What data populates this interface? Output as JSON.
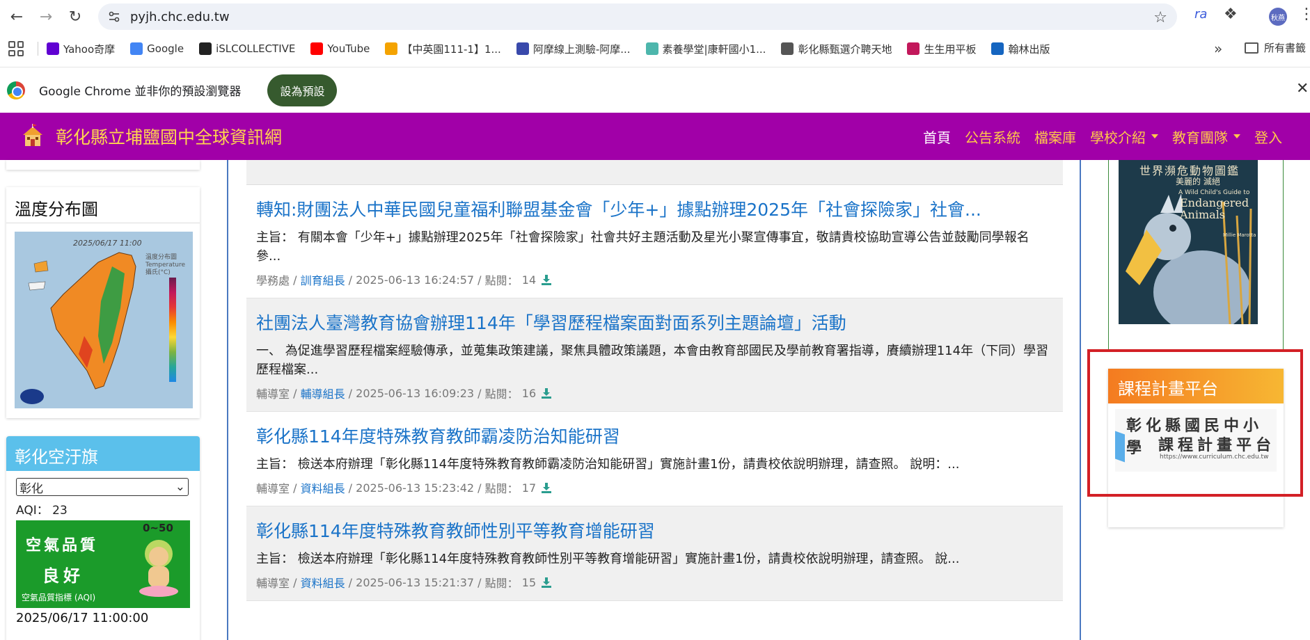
{
  "browser": {
    "url": "pyjh.chc.edu.tw",
    "extension_ra": "ra",
    "profile_initials": "秋燕"
  },
  "bookmarks": {
    "items": [
      {
        "label": "Yahoo奇摩",
        "icon": "yahoo-icon",
        "color": "#6001d2"
      },
      {
        "label": "Google",
        "icon": "google-icon",
        "color": "#4285f4"
      },
      {
        "label": "iSLCOLLECTIVE",
        "icon": "isl-icon",
        "color": "#222222"
      },
      {
        "label": "YouTube",
        "icon": "youtube-icon",
        "color": "#ff0000"
      },
      {
        "label": "【中英園111-1】1...",
        "icon": "pinwheel-icon",
        "color": "#f4a300"
      },
      {
        "label": "阿摩線上測驗-阿摩...",
        "icon": "amo-icon",
        "color": "#3949ab"
      },
      {
        "label": "素養學堂|康軒國小1...",
        "icon": "kangxuan-icon",
        "color": "#4db6ac"
      },
      {
        "label": "彰化縣甄選介聘天地",
        "icon": "globe-icon",
        "color": "#555555"
      },
      {
        "label": "生生用平板",
        "icon": "tablet-icon",
        "color": "#c2185b"
      },
      {
        "label": "翰林出版",
        "icon": "hanlin-icon",
        "color": "#1565c0"
      }
    ],
    "all_bookmarks": "所有書籤"
  },
  "infobar": {
    "message": "Google Chrome 並非你的預設瀏覽器",
    "button": "設為預設"
  },
  "site": {
    "title": "彰化縣立埔鹽國中全球資訊網",
    "nav": [
      {
        "label": "首頁",
        "active": true,
        "dropdown": false
      },
      {
        "label": "公告系統",
        "active": false,
        "dropdown": false
      },
      {
        "label": "檔案庫",
        "active": false,
        "dropdown": false
      },
      {
        "label": "學校介紹",
        "active": false,
        "dropdown": true
      },
      {
        "label": "教育團隊",
        "active": false,
        "dropdown": true
      },
      {
        "label": "登入",
        "active": false,
        "dropdown": false
      }
    ],
    "header_color": "#a100a8",
    "nav_color": "#ffc94a"
  },
  "temperature": {
    "title": "溫度分布圖",
    "map_date": "2025/06/17 11:00",
    "legend_title": "溫度分布圖 Temperature 攝氏(°C)"
  },
  "aqi": {
    "title": "彰化空汙旗",
    "selected_station": "彰化",
    "label": "AQI：",
    "value": "23",
    "banner_line1": "空氣品質",
    "banner_line2": "良好",
    "banner_caption": "空氣品質指標 (AQI)",
    "banner_range": "0~50",
    "timestamp": "2025/06/17 11:00:00"
  },
  "news": [
    {
      "title": "轉知:財團法人中華民國兒童福利聯盟基金會「少年+」據點辦理2025年「社會探險家」社會...",
      "body": "主旨： 有關本會「少年+」據點辦理2025年「社會探險家」社會共好主題活動及星光小聚宣傳事宜，敬請貴校協助宣導公告並鼓勵同學報名參...",
      "office": "學務處",
      "role": "訓育組長",
      "datetime": "2025-06-13 16:24:57",
      "hits_label": "點閱：",
      "hits": "14"
    },
    {
      "title": "社團法人臺灣教育協會辦理114年「學習歷程檔案面對面系列主題論壇」活動",
      "body": "一、 為促進學習歷程檔案經驗傳承，並蒐集政策建議，聚焦具體政策議題，本會由教育部國民及學前教育署指導，賡續辦理114年（下同）學習歷程檔案...",
      "office": "輔導室",
      "role": "輔導組長",
      "datetime": "2025-06-13 16:09:23",
      "hits_label": "點閱：",
      "hits": "16"
    },
    {
      "title": "彰化縣114年度特殊教育教師霸凌防治知能研習",
      "body": "主旨： 檢送本府辦理「彰化縣114年度特殊教育教師霸凌防治知能研習」實施計畫1份，請貴校依說明辦理，請查照。 說明：...",
      "office": "輔導室",
      "role": "資料組長",
      "datetime": "2025-06-13 15:23:42",
      "hits_label": "點閱：",
      "hits": "17"
    },
    {
      "title": "彰化縣114年度特殊教育教師性別平等教育增能研習",
      "body": "主旨： 檢送本府辦理「彰化縣114年度特殊教育教師性別平等教育增能研習」實施計畫1份，請貴校依說明辦理，請查照。 說...",
      "office": "輔導室",
      "role": "資料組長",
      "datetime": "2025-06-13 15:21:37",
      "hits_label": "點閱：",
      "hits": "15"
    }
  ],
  "book": {
    "title_cn": "世界瀕危動物圖鑑",
    "subtitle_cn": "美麗的 滅絕",
    "series_en": "A Wild Child's Guide to",
    "title_en": "Endangered Animals",
    "author": "Millie Marotta"
  },
  "curriculum": {
    "title": "課程計畫平台",
    "banner_line1": "彰化縣國民中小學",
    "banner_line2": "課程計畫平台",
    "banner_url": "https://www.curriculum.chc.edu.tw"
  }
}
